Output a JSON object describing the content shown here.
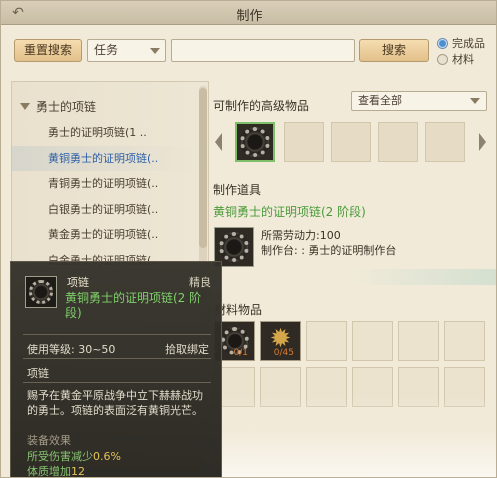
{
  "window": {
    "title": "制作"
  },
  "search": {
    "reset_label": "重置搜索",
    "type_value": "任务",
    "query_value": "",
    "search_label": "搜索",
    "radio_finished": "完成品",
    "radio_material": "材料",
    "selected_radio": "完成品"
  },
  "sidebar": {
    "group_label": "勇士的项链",
    "items": [
      {
        "label": "勇士的证明项链(1 .."
      },
      {
        "label": "黄铜勇士的证明项链(.."
      },
      {
        "label": "青铜勇士的证明项链(.."
      },
      {
        "label": "白银勇士的证明项链(.."
      },
      {
        "label": "黄金勇士的证明项链(.."
      },
      {
        "label": "白金勇士的证明项链(.."
      }
    ],
    "selected_index": 1
  },
  "craftable": {
    "label": "可制作的高级物品",
    "filter_value": "查看全部"
  },
  "tools": {
    "label": "制作道具",
    "item_name": "黄铜勇士的证明项链(2 阶段)",
    "labor": "所需劳动力:100",
    "station": "制作台: : 勇士的证明制作台"
  },
  "materials": {
    "label": "材料物品",
    "slot1_qty": "0/1",
    "slot2_qty": "0/45"
  },
  "tooltip": {
    "type": "项链",
    "grade": "精良",
    "name": "黄铜勇士的证明项链(2 阶段)",
    "level_req": "使用等级: 30~50",
    "bind": "拾取绑定",
    "category": "项链",
    "description": "赐予在黄金平原战争中立下赫赫战功的勇士。项链的表面泛有黄铜光芒。",
    "effect_title": "装备效果",
    "effect1_label": "所受伤害减少",
    "effect1_value": "0.6%",
    "effect2_label": "体质增加",
    "effect2_value": "12"
  },
  "colors": {
    "panel_bg": "#f1ead9",
    "selected_text": "#2c5fa8",
    "item_name_green": "#4a9a3a",
    "tooltip_bg": "#34322a",
    "button_bg": "#e2c08a"
  }
}
